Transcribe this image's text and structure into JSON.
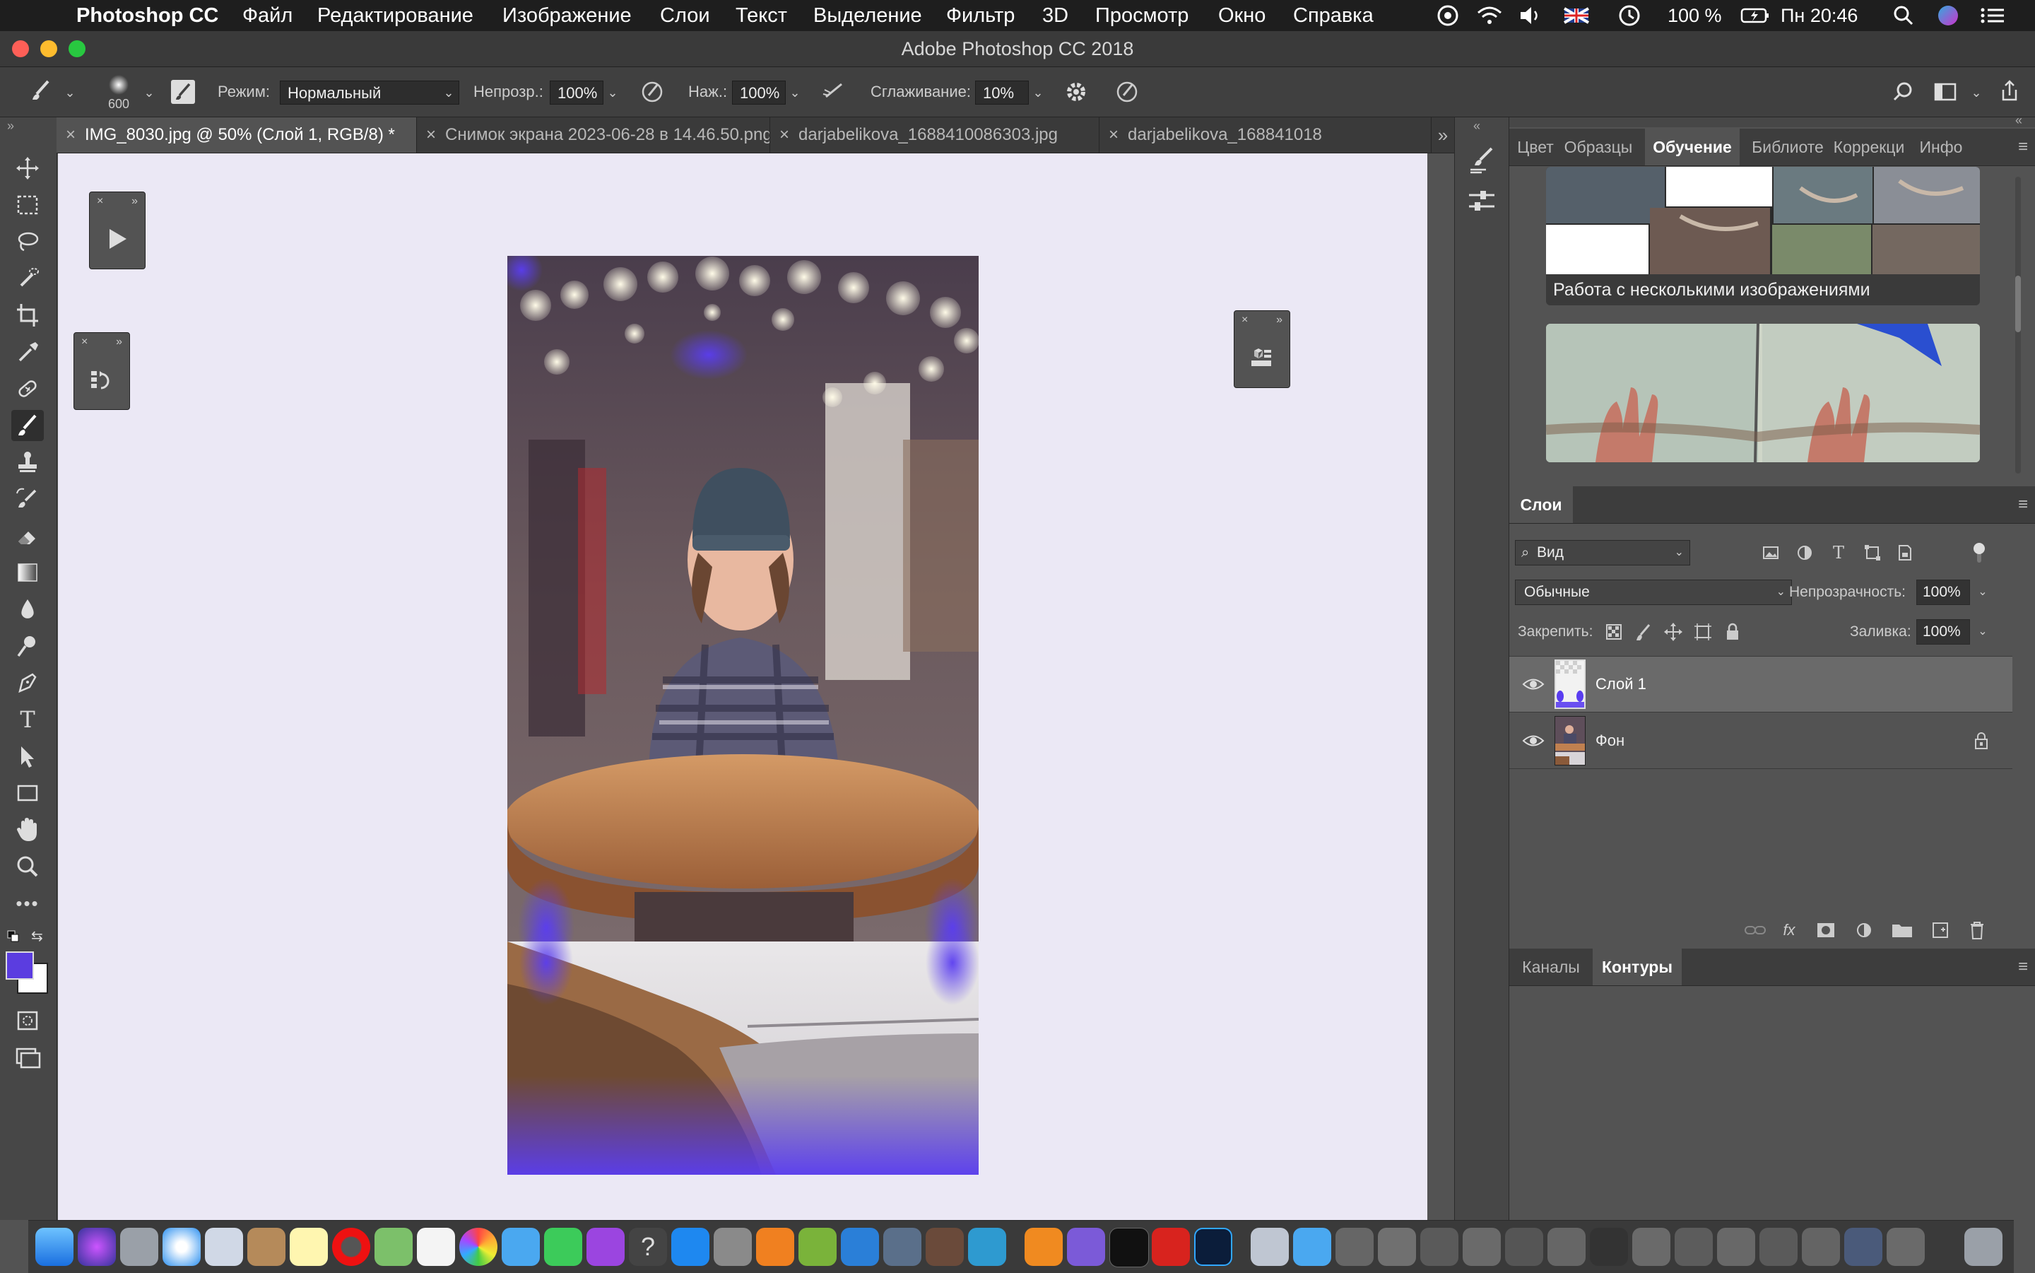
{
  "menubar": {
    "apple_icon": "apple-icon",
    "app_name": "Photoshop CC",
    "items": [
      "Файл",
      "Редактирование",
      "Изображение",
      "Слои",
      "Текст",
      "Выделение",
      "Фильтр",
      "3D",
      "Просмотр",
      "Окно",
      "Справка"
    ],
    "battery": "100 %",
    "clock": "Пн 20:46"
  },
  "window": {
    "title": "Adobe Photoshop CC 2018"
  },
  "options": {
    "brush_size": "600",
    "mode_label": "Режим:",
    "mode_value": "Нормальный",
    "opacity_label": "Непрозр.:",
    "opacity_value": "100%",
    "pressure_label": "Наж.:",
    "pressure_value": "100%",
    "smoothing_label": "Сглаживание:",
    "smoothing_value": "10%"
  },
  "tabs": [
    {
      "label": "IMG_8030.jpg @ 50% (Слой 1, RGB/8) *",
      "active": true
    },
    {
      "label": "Снимок экрана 2023-06-28 в 14.46.50.png",
      "active": false
    },
    {
      "label": "darjabelikova_1688410086303.jpg",
      "active": false
    },
    {
      "label": "darjabelikova_168841018",
      "active": false
    }
  ],
  "panels": {
    "top_tabs": [
      "Цвет",
      "Образцы",
      "Обучение",
      "Библиоте",
      "Коррекци",
      "Инфо"
    ],
    "top_active": "Обучение",
    "learn_cards": [
      {
        "caption": "Работа с несколькими изображениями"
      },
      {
        "caption": ""
      }
    ],
    "layers": {
      "tab": "Слои",
      "filter_value": "Вид",
      "blend_value": "Обычные",
      "opacity_label": "Непрозрачность:",
      "opacity_value": "100%",
      "lock_label": "Закрепить:",
      "fill_label": "Заливка:",
      "fill_value": "100%",
      "items": [
        {
          "name": "Слой 1",
          "selected": true
        },
        {
          "name": "Фон",
          "selected": false
        }
      ]
    },
    "bottom_tabs": [
      "Каналы",
      "Контуры"
    ],
    "bottom_active": "Контуры"
  },
  "colors": {
    "foreground": "#5b3de0",
    "background": "#ffffff",
    "canvas_bg": "#ebe8f5",
    "accent_purple": "#5a3df0"
  }
}
